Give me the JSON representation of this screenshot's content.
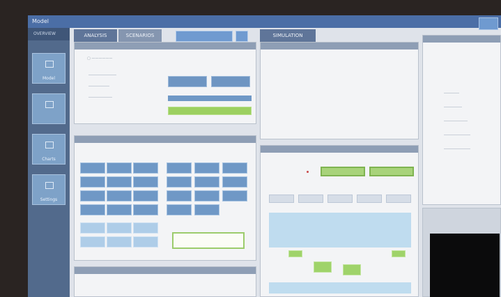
{
  "window": {
    "title": "Model"
  },
  "left_nav": {
    "header": "OVERVIEW",
    "items": [
      {
        "label": "Model",
        "icon": "grid-icon"
      },
      {
        "label": "",
        "icon": "monitor-icon"
      },
      {
        "label": "Charts",
        "icon": "chart-icon"
      },
      {
        "label": "Settings",
        "icon": "sliders-icon"
      }
    ]
  },
  "tabs": {
    "left": "ANALYSIS",
    "right": "SCENARIOS",
    "right_panel": "SIMULATION"
  },
  "panels": {
    "top_left": {
      "header": ""
    },
    "mid_left": {
      "header": ""
    },
    "bottom_left": {
      "header": ""
    },
    "top_center": {
      "header": ""
    },
    "mid_center": {
      "header": ""
    },
    "right_top": {
      "header": ""
    }
  },
  "toolbar": {
    "primary_button": "",
    "icon_button": "menu-icon"
  },
  "input": {
    "placeholder": ""
  },
  "labels": {
    "status": "",
    "mid_center_label": ""
  }
}
